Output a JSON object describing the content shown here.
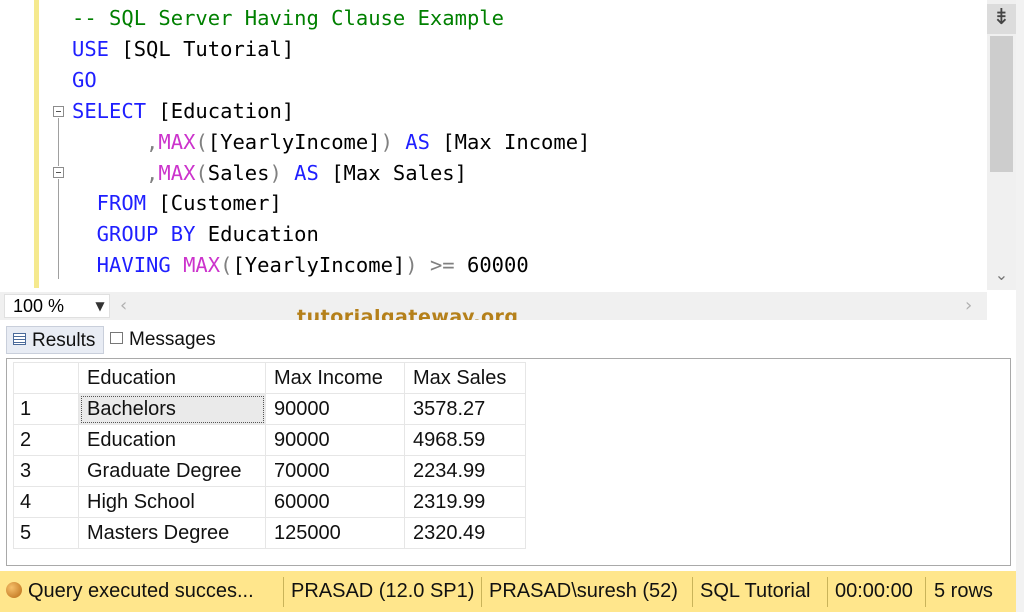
{
  "editor": {
    "lines": [
      [
        {
          "t": "-- SQL Server Having Clause Example",
          "c": "cm"
        }
      ],
      [
        {
          "t": "USE ",
          "c": "kw"
        },
        {
          "t": "[SQL Tutorial]",
          "c": ""
        }
      ],
      [
        {
          "t": "GO",
          "c": "kw"
        }
      ],
      [
        {
          "t": "SELECT ",
          "c": "kw"
        },
        {
          "t": "[Education]",
          "c": ""
        }
      ],
      [
        {
          "t": "      ,",
          "c": "op"
        },
        {
          "t": "MAX",
          "c": "fn"
        },
        {
          "t": "(",
          "c": "op"
        },
        {
          "t": "[YearlyIncome]",
          "c": ""
        },
        {
          "t": ")",
          "c": "op"
        },
        {
          "t": " AS ",
          "c": "kw"
        },
        {
          "t": "[Max Income]",
          "c": ""
        }
      ],
      [
        {
          "t": "      ,",
          "c": "op"
        },
        {
          "t": "MAX",
          "c": "fn"
        },
        {
          "t": "(",
          "c": "op"
        },
        {
          "t": "Sales",
          "c": ""
        },
        {
          "t": ")",
          "c": "op"
        },
        {
          "t": " AS ",
          "c": "kw"
        },
        {
          "t": "[Max Sales]",
          "c": ""
        }
      ],
      [
        {
          "t": "  FROM ",
          "c": "kw"
        },
        {
          "t": "[Customer]",
          "c": ""
        }
      ],
      [
        {
          "t": "  GROUP BY ",
          "c": "kw"
        },
        {
          "t": "Education",
          "c": ""
        }
      ],
      [
        {
          "t": "  HAVING ",
          "c": "kw"
        },
        {
          "t": "MAX",
          "c": "fn"
        },
        {
          "t": "(",
          "c": "op"
        },
        {
          "t": "[YearlyIncome]",
          "c": ""
        },
        {
          "t": ") >= ",
          "c": "op"
        },
        {
          "t": "60000",
          "c": ""
        }
      ]
    ]
  },
  "zoom": {
    "value": "100 %"
  },
  "watermark": "tutorialgateway.org",
  "tabs": {
    "results": "Results",
    "messages": "Messages"
  },
  "grid": {
    "columns": [
      "Education",
      "Max Income",
      "Max Sales"
    ],
    "rows": [
      {
        "n": "1",
        "education": "Bachelors",
        "max_income": "90000",
        "max_sales": "3578.27"
      },
      {
        "n": "2",
        "education": "Education",
        "max_income": "90000",
        "max_sales": "4968.59"
      },
      {
        "n": "3",
        "education": "Graduate Degree",
        "max_income": "70000",
        "max_sales": "2234.99"
      },
      {
        "n": "4",
        "education": "High School",
        "max_income": "60000",
        "max_sales": "2319.99"
      },
      {
        "n": "5",
        "education": "Masters Degree",
        "max_income": "125000",
        "max_sales": "2320.49"
      }
    ]
  },
  "status": {
    "message": "Query executed succes...",
    "server": "PRASAD (12.0 SP1)",
    "user": "PRASAD\\suresh (52)",
    "database": "SQL Tutorial",
    "elapsed": "00:00:00",
    "rows": "5 rows"
  },
  "colors": {
    "keyword": "#1f1fff",
    "function": "#cc33cc",
    "operator": "#808080",
    "comment": "#008000",
    "statusbar": "#ffe68c"
  }
}
